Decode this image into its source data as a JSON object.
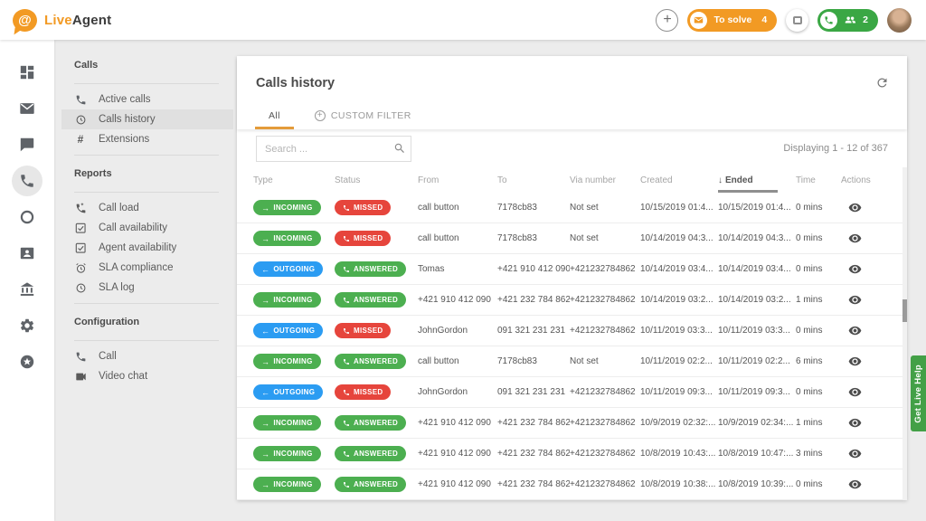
{
  "topbar": {
    "brand": {
      "first": "Live",
      "second": "Agent"
    },
    "to_solve": {
      "label": "To solve",
      "count": "4"
    },
    "online_calls": {
      "count": "2"
    }
  },
  "icon_rail": {
    "items": [
      "dashboard",
      "mail",
      "chat",
      "phone",
      "ring",
      "contacts",
      "bank",
      "settings",
      "star"
    ],
    "active": "phone"
  },
  "sidebar": {
    "sections": [
      {
        "title": "Calls",
        "items": [
          {
            "icon": "phone",
            "label": "Active calls"
          },
          {
            "icon": "history",
            "label": "Calls history",
            "selected": true
          },
          {
            "icon": "hash",
            "label": "Extensions"
          }
        ]
      },
      {
        "title": "Reports",
        "items": [
          {
            "icon": "phone-load",
            "label": "Call load"
          },
          {
            "icon": "checkbox",
            "label": "Call availability"
          },
          {
            "icon": "checkbox",
            "label": "Agent availability"
          },
          {
            "icon": "alarm",
            "label": "SLA compliance"
          },
          {
            "icon": "history",
            "label": "SLA log"
          }
        ]
      },
      {
        "title": "Configuration",
        "items": [
          {
            "icon": "phone",
            "label": "Call"
          },
          {
            "icon": "video",
            "label": "Video chat"
          }
        ]
      }
    ]
  },
  "panel": {
    "title": "Calls history",
    "tabs": [
      {
        "label": "All",
        "active": true
      },
      {
        "label": "CUSTOM FILTER",
        "icon": "plus-circle",
        "active": false
      }
    ],
    "search_placeholder": "Search ...",
    "displaying": "Displaying 1 - 12 of 367",
    "table": {
      "columns": [
        "Type",
        "Status",
        "From",
        "To",
        "Via number",
        "Created",
        "Ended",
        "Time",
        "Actions"
      ],
      "sorted_column": "Ended",
      "sort_direction": "desc",
      "rows": [
        {
          "type": "INCOMING",
          "status": "MISSED",
          "from": "call button",
          "to": "7178cb83",
          "via": "Not set",
          "created": "10/15/2019 01:4...",
          "ended": "10/15/2019 01:4...",
          "time": "0 mins"
        },
        {
          "type": "INCOMING",
          "status": "MISSED",
          "from": "call button",
          "to": "7178cb83",
          "via": "Not set",
          "created": "10/14/2019 04:3...",
          "ended": "10/14/2019 04:3...",
          "time": "0 mins"
        },
        {
          "type": "OUTGOING",
          "status": "ANSWERED",
          "from": "Tomas",
          "to": "+421 910 412 090",
          "via": "+421232784862",
          "created": "10/14/2019 03:4...",
          "ended": "10/14/2019 03:4...",
          "time": "0 mins"
        },
        {
          "type": "INCOMING",
          "status": "ANSWERED",
          "from": "+421 910 412 090",
          "to": "+421 232 784 862",
          "via": "+421232784862",
          "created": "10/14/2019 03:2...",
          "ended": "10/14/2019 03:2...",
          "time": "1 mins"
        },
        {
          "type": "OUTGOING",
          "status": "MISSED",
          "from": "JohnGordon",
          "to": "091 321 231 231",
          "via": "+421232784862",
          "created": "10/11/2019 03:3...",
          "ended": "10/11/2019 03:3...",
          "time": "0 mins"
        },
        {
          "type": "INCOMING",
          "status": "ANSWERED",
          "from": "call button",
          "to": "7178cb83",
          "via": "Not set",
          "created": "10/11/2019 02:2...",
          "ended": "10/11/2019 02:2...",
          "time": "6 mins"
        },
        {
          "type": "OUTGOING",
          "status": "MISSED",
          "from": "JohnGordon",
          "to": "091 321 231 231",
          "via": "+421232784862",
          "created": "10/11/2019 09:3...",
          "ended": "10/11/2019 09:3...",
          "time": "0 mins"
        },
        {
          "type": "INCOMING",
          "status": "ANSWERED",
          "from": "+421 910 412 090",
          "to": "+421 232 784 862",
          "via": "+421232784862",
          "created": "10/9/2019 02:32:...",
          "ended": "10/9/2019 02:34:...",
          "time": "1 mins"
        },
        {
          "type": "INCOMING",
          "status": "ANSWERED",
          "from": "+421 910 412 090",
          "to": "+421 232 784 862",
          "via": "+421232784862",
          "created": "10/8/2019 10:43:...",
          "ended": "10/8/2019 10:47:...",
          "time": "3 mins"
        },
        {
          "type": "INCOMING",
          "status": "ANSWERED",
          "from": "+421 910 412 090",
          "to": "+421 232 784 862",
          "via": "+421232784862",
          "created": "10/8/2019 10:38:...",
          "ended": "10/8/2019 10:39:...",
          "time": "0 mins"
        }
      ]
    }
  },
  "help_tab": {
    "label": "Get Live Help"
  },
  "colors": {
    "accent_orange": "#f29a24",
    "green": "#4caf50",
    "red": "#e6453c",
    "blue": "#2b9cf2",
    "topbar_green": "#3aa744",
    "help_green": "#43a047"
  }
}
